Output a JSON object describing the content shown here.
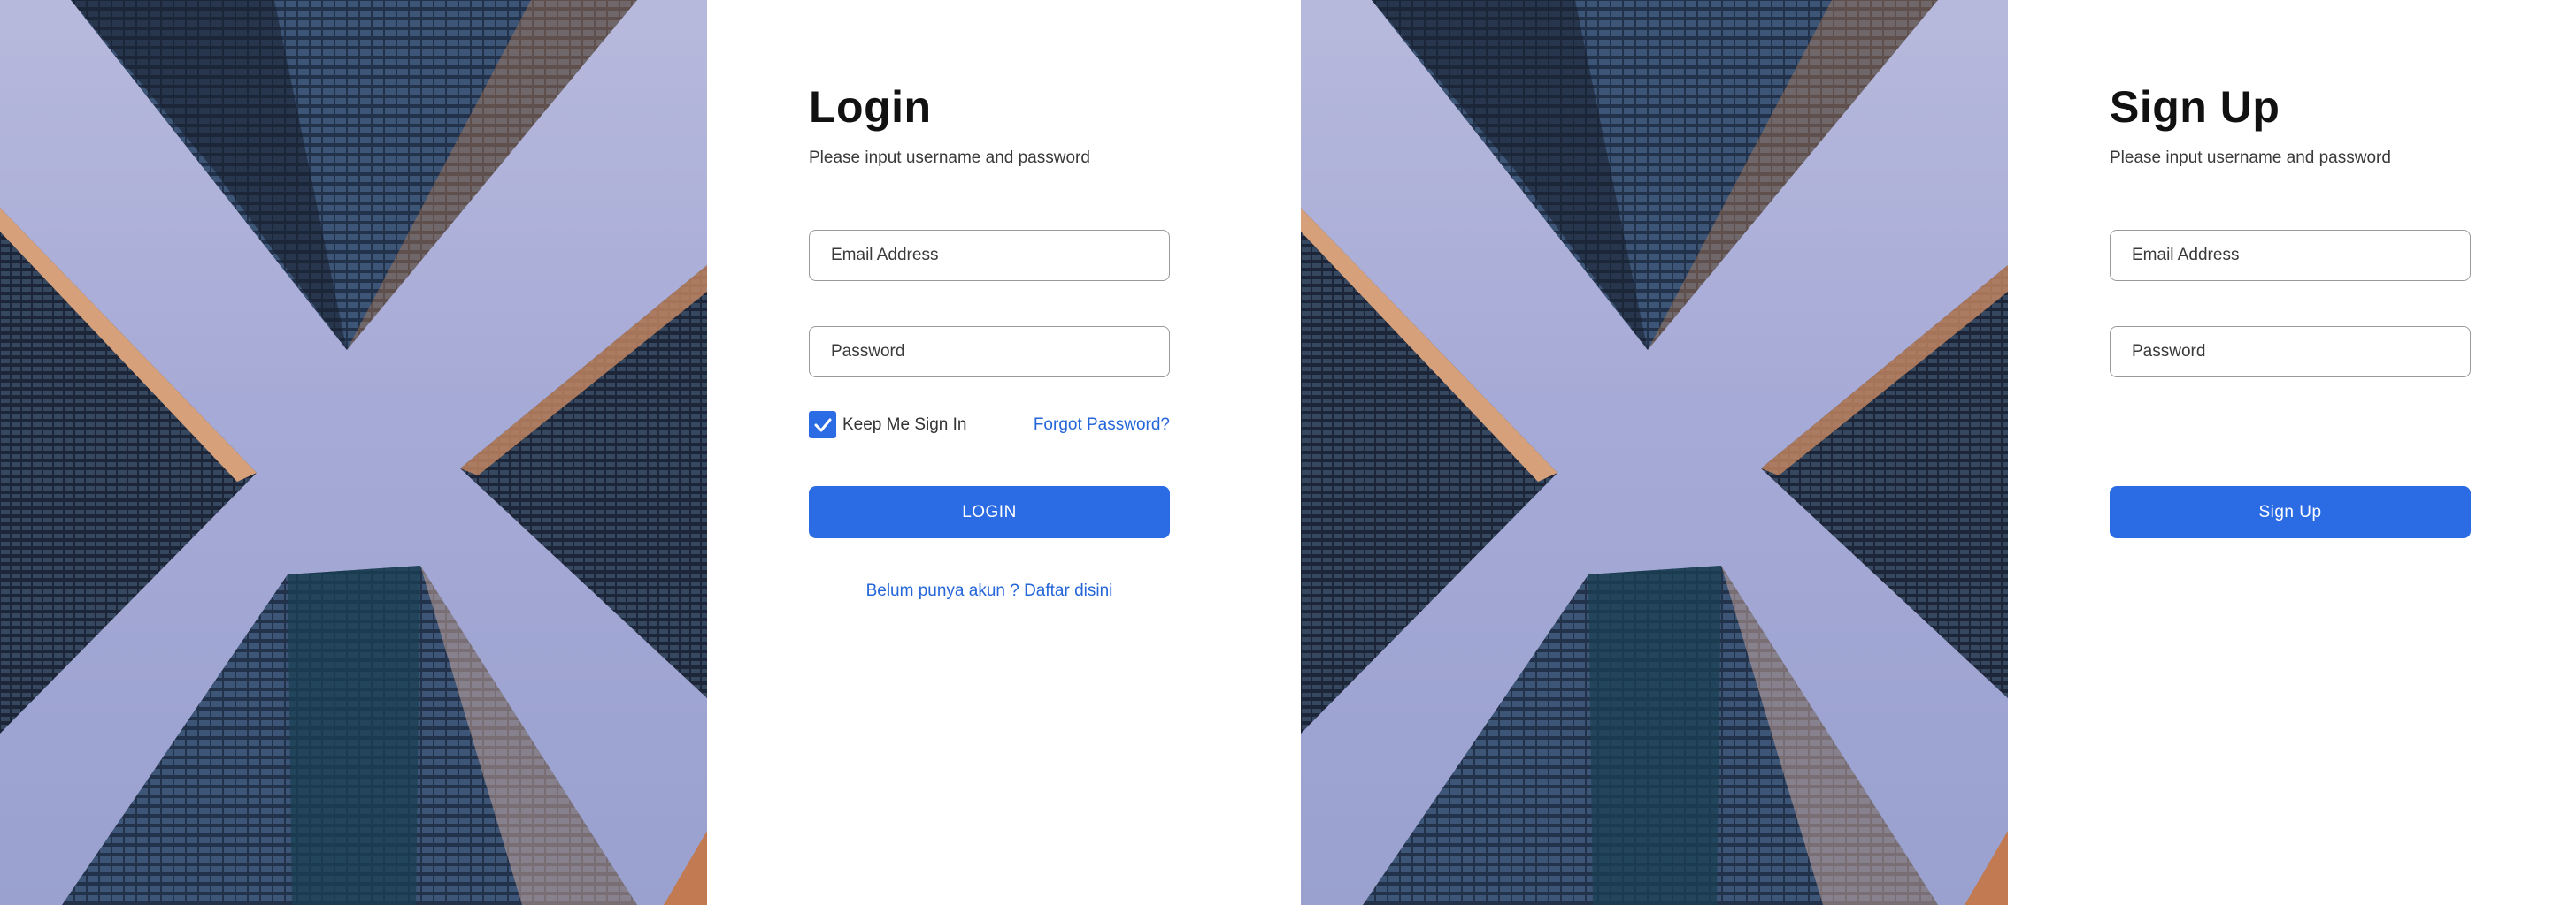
{
  "colors": {
    "accent": "#2b6be3",
    "link": "#2566d8",
    "field_border": "#9a9a9a",
    "sky": "#a6aad6"
  },
  "login": {
    "title": "Login",
    "subtitle": "Please input username and password",
    "email_placeholder": "Email Address",
    "password_placeholder": "Password",
    "keep_signed_in": {
      "label": "Keep Me Sign In",
      "checked": true
    },
    "forgot_password": "Forgot Password?",
    "submit_label": "LOGIN",
    "register_link": "Belum punya akun ? Daftar disini"
  },
  "signup": {
    "title": "Sign Up",
    "subtitle": "Please input username and password",
    "email_placeholder": "Email Address",
    "password_placeholder": "Password",
    "submit_label": "Sign Up"
  },
  "icons": {
    "checkbox": "checkmark-icon",
    "photo": "skyscrapers-image"
  }
}
